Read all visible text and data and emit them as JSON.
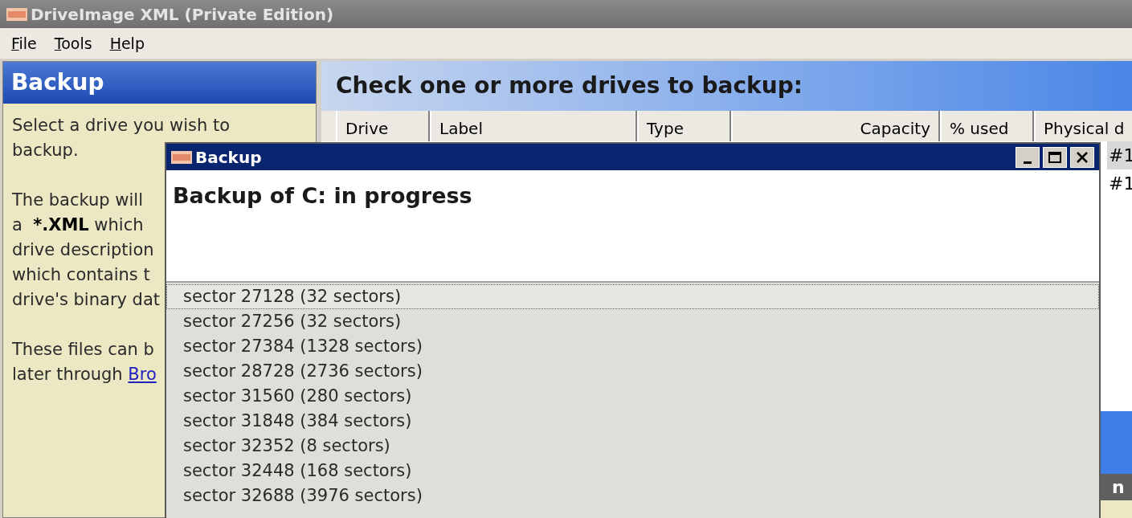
{
  "window": {
    "title": "DriveImage XML (Private Edition)"
  },
  "menu": [
    {
      "mnemonic": "F",
      "rest": "ile"
    },
    {
      "mnemonic": "T",
      "rest": "ools"
    },
    {
      "mnemonic": "H",
      "rest": "elp"
    }
  ],
  "sidebar": {
    "title": "Backup",
    "paragraphs": [
      [
        [
          {
            "text": "Select a drive you wish to"
          }
        ],
        [
          {
            "text": "backup."
          }
        ]
      ],
      [
        [
          {
            "text": "The backup will"
          }
        ],
        [
          {
            "text": "a  "
          },
          {
            "text": "*.XML",
            "bold": true
          },
          {
            "text": " which"
          }
        ],
        [
          {
            "text": "drive description"
          }
        ],
        [
          {
            "text": "which contains t"
          }
        ],
        [
          {
            "text": "drive's binary dat"
          }
        ]
      ],
      [
        [
          {
            "text": "These files can b"
          }
        ],
        [
          {
            "text": "later through "
          },
          {
            "text": "Bro",
            "link": true
          }
        ]
      ]
    ]
  },
  "main": {
    "heading": "Check one or more drives to backup:",
    "table": {
      "columns": [
        {
          "label": "Drive",
          "align_right": false
        },
        {
          "label": "Label",
          "align_right": false
        },
        {
          "label": "Type",
          "align_right": false
        },
        {
          "label": "Capacity",
          "align_right": true
        },
        {
          "label": "% used",
          "align_right": false
        },
        {
          "label": "Physical d",
          "align_right": false
        }
      ],
      "rows": [
        {
          "physical": "#1",
          "selected": true
        },
        {
          "physical": "#1",
          "selected": false
        }
      ]
    },
    "bottom_bar": {
      "text": "n"
    }
  },
  "dialog": {
    "title": "Backup",
    "status": "Backup of C: in progress",
    "log": [
      {
        "text": "sector 27128 (32 sectors)",
        "selected": true
      },
      {
        "text": "sector 27256 (32 sectors)",
        "selected": false
      },
      {
        "text": "sector 27384 (1328 sectors)",
        "selected": false
      },
      {
        "text": "sector 28728 (2736 sectors)",
        "selected": false
      },
      {
        "text": "sector 31560 (280 sectors)",
        "selected": false
      },
      {
        "text": "sector 31848 (384 sectors)",
        "selected": false
      },
      {
        "text": "sector 32352 (8 sectors)",
        "selected": false
      },
      {
        "text": "sector 32448 (168 sectors)",
        "selected": false
      },
      {
        "text": "sector 32688 (3976 sectors)",
        "selected": false
      }
    ]
  }
}
